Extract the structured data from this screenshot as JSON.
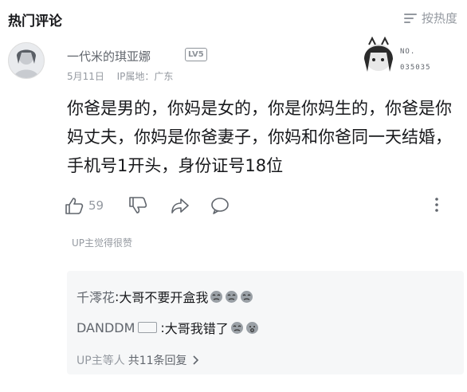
{
  "header": {
    "title": "热门评论",
    "sort_label": "按热度"
  },
  "comment": {
    "username": "一代米的琪亚娜",
    "level": "LV5",
    "date": "5月11日",
    "ip_location": "IP属地：广东",
    "fan_badge": {
      "no_label": "NO.",
      "number": "035035"
    },
    "text": "你爸是男的，你妈是女的，你是你妈生的，你爸是你妈丈夫，你妈是你爸妻子，你妈和你爸同一天结婚，手机号1开头，身份证号18位",
    "like_count": "59",
    "up_liked": "UP主觉得很赞"
  },
  "replies": [
    {
      "name": "千澪花",
      "separator": ": ",
      "text": "大哥不要开盒我",
      "emoji_count": 3
    },
    {
      "name": "DANDDM",
      "separator": ": ",
      "text": "大哥我错了",
      "emoji_count": 2
    }
  ],
  "reply_summary": {
    "prefix": "UP主等人",
    "count_text": "共11条回复"
  }
}
